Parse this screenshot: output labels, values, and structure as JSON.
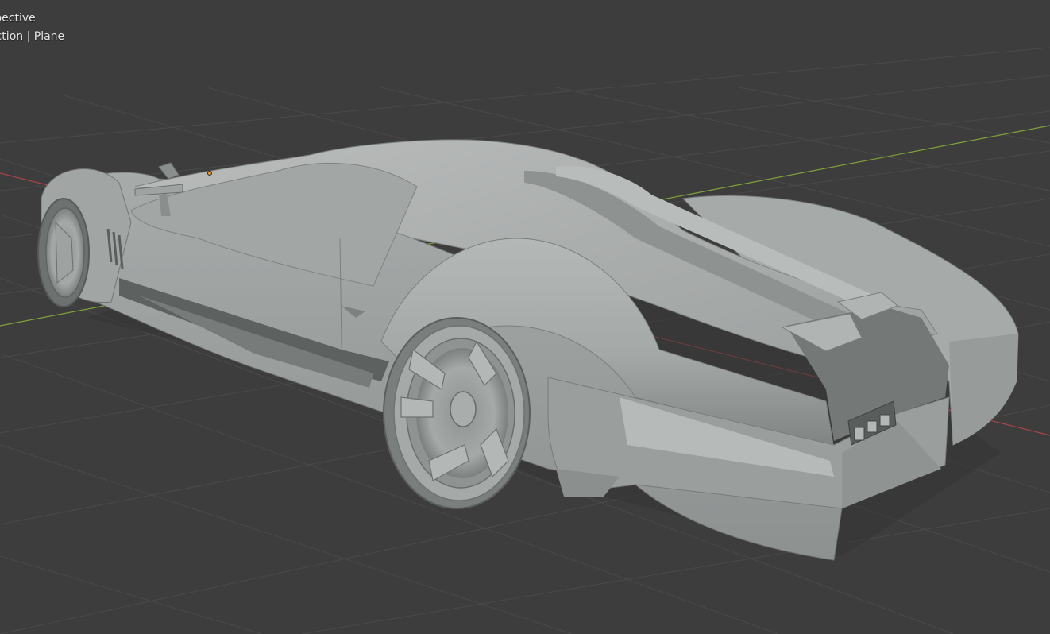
{
  "viewport": {
    "view_name": "spective",
    "collection_info": "ection | Plane",
    "background_color": "#3d3d3d",
    "grid_color": "#4a4a4a",
    "x_axis_color": "#a8454a",
    "y_axis_color": "#7fa23a",
    "origin_color": "#f0952c",
    "model_color": "#a9adac"
  }
}
